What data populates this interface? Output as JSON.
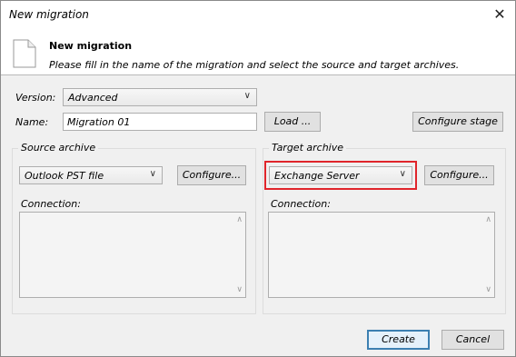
{
  "window": {
    "title": "New migration",
    "close_glyph": "✕"
  },
  "header": {
    "icon": "document-icon",
    "title": "New migration",
    "subtitle": "Please fill in the name of the migration and select the source and target archives."
  },
  "form": {
    "version_label": "Version:",
    "version_value": "Advanced",
    "name_label": "Name:",
    "name_value": "Migration 01",
    "load_label": "Load ...",
    "configure_stage_label": "Configure stage"
  },
  "source": {
    "group_title": "Source archive",
    "archive_value": "Outlook PST file",
    "configure_label": "Configure...",
    "connection_label": "Connection:"
  },
  "target": {
    "group_title": "Target archive",
    "archive_value": "Exchange Server",
    "configure_label": "Configure...",
    "connection_label": "Connection:"
  },
  "footer": {
    "create_label": "Create",
    "cancel_label": "Cancel"
  },
  "colors": {
    "highlight": "#e0252b",
    "primary_border": "#3c7fb1"
  }
}
